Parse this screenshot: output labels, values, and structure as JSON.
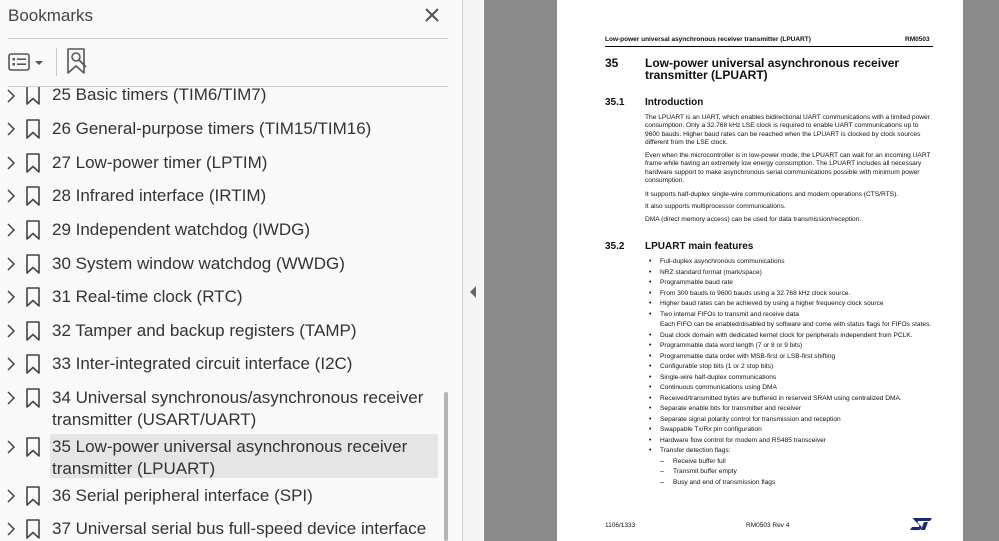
{
  "panel": {
    "title": "Bookmarks",
    "items": [
      {
        "label": "25 Basic timers (TIM6/TIM7)"
      },
      {
        "label": "26 General-purpose timers (TIM15/TIM16)"
      },
      {
        "label": "27 Low-power timer (LPTIM)"
      },
      {
        "label": "28 Infrared interface (IRTIM)"
      },
      {
        "label": "29 Independent watchdog (IWDG)"
      },
      {
        "label": "30 System window watchdog (WWDG)"
      },
      {
        "label": "31 Real-time clock (RTC)"
      },
      {
        "label": "32 Tamper and backup registers (TAMP)"
      },
      {
        "label": "33 Inter-integrated circuit interface (I2C)"
      },
      {
        "label": "34 Universal synchronous/asynchronous receiver transmitter (USART/UART)"
      },
      {
        "label": "35 Low-power universal asynchronous receiver transmitter (LPUART)",
        "selected": true
      },
      {
        "label": "36 Serial peripheral interface (SPI)"
      },
      {
        "label": "37 Universal serial bus full-speed device interface"
      }
    ]
  },
  "page": {
    "running_title": "Low-power universal asynchronous receiver transmitter (LPUART)",
    "doc_id": "RM0503",
    "chapter_num": "35",
    "chapter_title": "Low-power universal asynchronous receiver transmitter (LPUART)",
    "s1_num": "35.1",
    "s1_title": "Introduction",
    "intro": [
      "The LPUART is an UART, which enables bidirectional UART communications with a limited power consumption. Only a 32.768 kHz LSE clock is required to enable UART communications up to 9600 bauds. Higher baud rates can be reached when the LPUART is clocked by clock sources different from the LSE clock.",
      "Even when the microcontroller is in low-power mode, the LPUART can wait for an incoming UART frame while having an extremely low energy consumption. The LPUART includes all necessary hardware support to make asynchronous serial communications possible with minimum power consumption.",
      "It supports half-duplex single-wire communications and modem operations (CTS/RTS).",
      "It also supports multiprocessor communications.",
      "DMA (direct memory access) can be used for data transmission/reception."
    ],
    "s2_num": "35.2",
    "s2_title": "LPUART main features",
    "features": [
      "Full-duplex asynchronous communications",
      "NRZ standard format (mark/space)",
      "Programmable baud rate",
      "From 300 bauds to 9600 bauds using a 32.768 kHz clock source.",
      "Higher baud rates can be achieved by using a higher frequency clock source",
      "Two internal FIFOs to transmit and receive data",
      "Each FIFO can be enabled/disabled by software and come with status flags for FIFOs states.",
      "Dual clock domain with dedicated kernel clock for peripherals independent from PCLK.",
      "Programmable data word length (7 or 8 or 9 bits)",
      "Programmable data order with MSB-first or LSB-first shifting",
      "Configurable stop bits (1 or 2 stop bits)",
      "Single-wire half-duplex communications",
      "Continuous communications using DMA",
      "Received/transmitted bytes are buffered in reserved SRAM using centralized DMA.",
      "Separate enable bits for transmitter and receiver",
      "Separate signal polarity control for transmission and reception",
      "Swappable Tx/Rx pin configuration",
      "Hardware flow control for modem and RS485 transceiver",
      "Transfer detection flags:",
      "Receive buffer full",
      "Transmit buffer empty",
      "Busy and end of transmission flags"
    ],
    "footer_page": "1106/1333",
    "footer_doc": "RM0503 Rev 4",
    "logo": "ST"
  }
}
